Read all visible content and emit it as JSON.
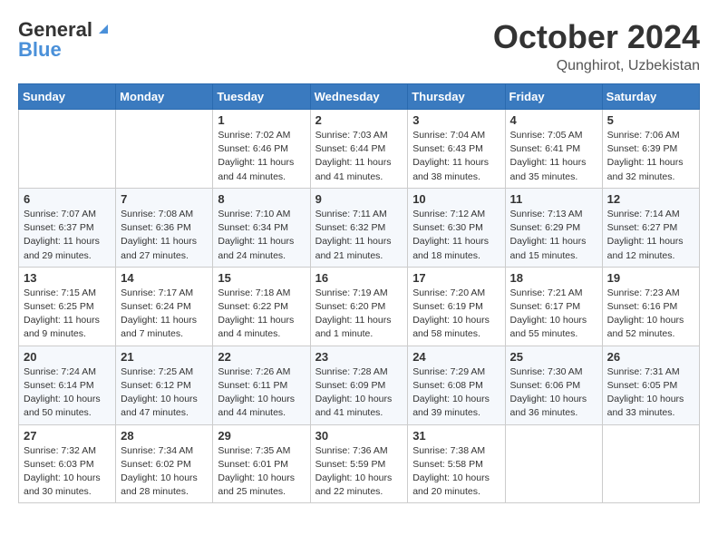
{
  "logo": {
    "general": "General",
    "blue": "Blue"
  },
  "title": "October 2024",
  "location": "Qunghirot, Uzbekistan",
  "days_of_week": [
    "Sunday",
    "Monday",
    "Tuesday",
    "Wednesday",
    "Thursday",
    "Friday",
    "Saturday"
  ],
  "weeks": [
    [
      {
        "day": "",
        "sunrise": "",
        "sunset": "",
        "daylight": ""
      },
      {
        "day": "",
        "sunrise": "",
        "sunset": "",
        "daylight": ""
      },
      {
        "day": "1",
        "sunrise": "Sunrise: 7:02 AM",
        "sunset": "Sunset: 6:46 PM",
        "daylight": "Daylight: 11 hours and 44 minutes."
      },
      {
        "day": "2",
        "sunrise": "Sunrise: 7:03 AM",
        "sunset": "Sunset: 6:44 PM",
        "daylight": "Daylight: 11 hours and 41 minutes."
      },
      {
        "day": "3",
        "sunrise": "Sunrise: 7:04 AM",
        "sunset": "Sunset: 6:43 PM",
        "daylight": "Daylight: 11 hours and 38 minutes."
      },
      {
        "day": "4",
        "sunrise": "Sunrise: 7:05 AM",
        "sunset": "Sunset: 6:41 PM",
        "daylight": "Daylight: 11 hours and 35 minutes."
      },
      {
        "day": "5",
        "sunrise": "Sunrise: 7:06 AM",
        "sunset": "Sunset: 6:39 PM",
        "daylight": "Daylight: 11 hours and 32 minutes."
      }
    ],
    [
      {
        "day": "6",
        "sunrise": "Sunrise: 7:07 AM",
        "sunset": "Sunset: 6:37 PM",
        "daylight": "Daylight: 11 hours and 29 minutes."
      },
      {
        "day": "7",
        "sunrise": "Sunrise: 7:08 AM",
        "sunset": "Sunset: 6:36 PM",
        "daylight": "Daylight: 11 hours and 27 minutes."
      },
      {
        "day": "8",
        "sunrise": "Sunrise: 7:10 AM",
        "sunset": "Sunset: 6:34 PM",
        "daylight": "Daylight: 11 hours and 24 minutes."
      },
      {
        "day": "9",
        "sunrise": "Sunrise: 7:11 AM",
        "sunset": "Sunset: 6:32 PM",
        "daylight": "Daylight: 11 hours and 21 minutes."
      },
      {
        "day": "10",
        "sunrise": "Sunrise: 7:12 AM",
        "sunset": "Sunset: 6:30 PM",
        "daylight": "Daylight: 11 hours and 18 minutes."
      },
      {
        "day": "11",
        "sunrise": "Sunrise: 7:13 AM",
        "sunset": "Sunset: 6:29 PM",
        "daylight": "Daylight: 11 hours and 15 minutes."
      },
      {
        "day": "12",
        "sunrise": "Sunrise: 7:14 AM",
        "sunset": "Sunset: 6:27 PM",
        "daylight": "Daylight: 11 hours and 12 minutes."
      }
    ],
    [
      {
        "day": "13",
        "sunrise": "Sunrise: 7:15 AM",
        "sunset": "Sunset: 6:25 PM",
        "daylight": "Daylight: 11 hours and 9 minutes."
      },
      {
        "day": "14",
        "sunrise": "Sunrise: 7:17 AM",
        "sunset": "Sunset: 6:24 PM",
        "daylight": "Daylight: 11 hours and 7 minutes."
      },
      {
        "day": "15",
        "sunrise": "Sunrise: 7:18 AM",
        "sunset": "Sunset: 6:22 PM",
        "daylight": "Daylight: 11 hours and 4 minutes."
      },
      {
        "day": "16",
        "sunrise": "Sunrise: 7:19 AM",
        "sunset": "Sunset: 6:20 PM",
        "daylight": "Daylight: 11 hours and 1 minute."
      },
      {
        "day": "17",
        "sunrise": "Sunrise: 7:20 AM",
        "sunset": "Sunset: 6:19 PM",
        "daylight": "Daylight: 10 hours and 58 minutes."
      },
      {
        "day": "18",
        "sunrise": "Sunrise: 7:21 AM",
        "sunset": "Sunset: 6:17 PM",
        "daylight": "Daylight: 10 hours and 55 minutes."
      },
      {
        "day": "19",
        "sunrise": "Sunrise: 7:23 AM",
        "sunset": "Sunset: 6:16 PM",
        "daylight": "Daylight: 10 hours and 52 minutes."
      }
    ],
    [
      {
        "day": "20",
        "sunrise": "Sunrise: 7:24 AM",
        "sunset": "Sunset: 6:14 PM",
        "daylight": "Daylight: 10 hours and 50 minutes."
      },
      {
        "day": "21",
        "sunrise": "Sunrise: 7:25 AM",
        "sunset": "Sunset: 6:12 PM",
        "daylight": "Daylight: 10 hours and 47 minutes."
      },
      {
        "day": "22",
        "sunrise": "Sunrise: 7:26 AM",
        "sunset": "Sunset: 6:11 PM",
        "daylight": "Daylight: 10 hours and 44 minutes."
      },
      {
        "day": "23",
        "sunrise": "Sunrise: 7:28 AM",
        "sunset": "Sunset: 6:09 PM",
        "daylight": "Daylight: 10 hours and 41 minutes."
      },
      {
        "day": "24",
        "sunrise": "Sunrise: 7:29 AM",
        "sunset": "Sunset: 6:08 PM",
        "daylight": "Daylight: 10 hours and 39 minutes."
      },
      {
        "day": "25",
        "sunrise": "Sunrise: 7:30 AM",
        "sunset": "Sunset: 6:06 PM",
        "daylight": "Daylight: 10 hours and 36 minutes."
      },
      {
        "day": "26",
        "sunrise": "Sunrise: 7:31 AM",
        "sunset": "Sunset: 6:05 PM",
        "daylight": "Daylight: 10 hours and 33 minutes."
      }
    ],
    [
      {
        "day": "27",
        "sunrise": "Sunrise: 7:32 AM",
        "sunset": "Sunset: 6:03 PM",
        "daylight": "Daylight: 10 hours and 30 minutes."
      },
      {
        "day": "28",
        "sunrise": "Sunrise: 7:34 AM",
        "sunset": "Sunset: 6:02 PM",
        "daylight": "Daylight: 10 hours and 28 minutes."
      },
      {
        "day": "29",
        "sunrise": "Sunrise: 7:35 AM",
        "sunset": "Sunset: 6:01 PM",
        "daylight": "Daylight: 10 hours and 25 minutes."
      },
      {
        "day": "30",
        "sunrise": "Sunrise: 7:36 AM",
        "sunset": "Sunset: 5:59 PM",
        "daylight": "Daylight: 10 hours and 22 minutes."
      },
      {
        "day": "31",
        "sunrise": "Sunrise: 7:38 AM",
        "sunset": "Sunset: 5:58 PM",
        "daylight": "Daylight: 10 hours and 20 minutes."
      },
      {
        "day": "",
        "sunrise": "",
        "sunset": "",
        "daylight": ""
      },
      {
        "day": "",
        "sunrise": "",
        "sunset": "",
        "daylight": ""
      }
    ]
  ]
}
